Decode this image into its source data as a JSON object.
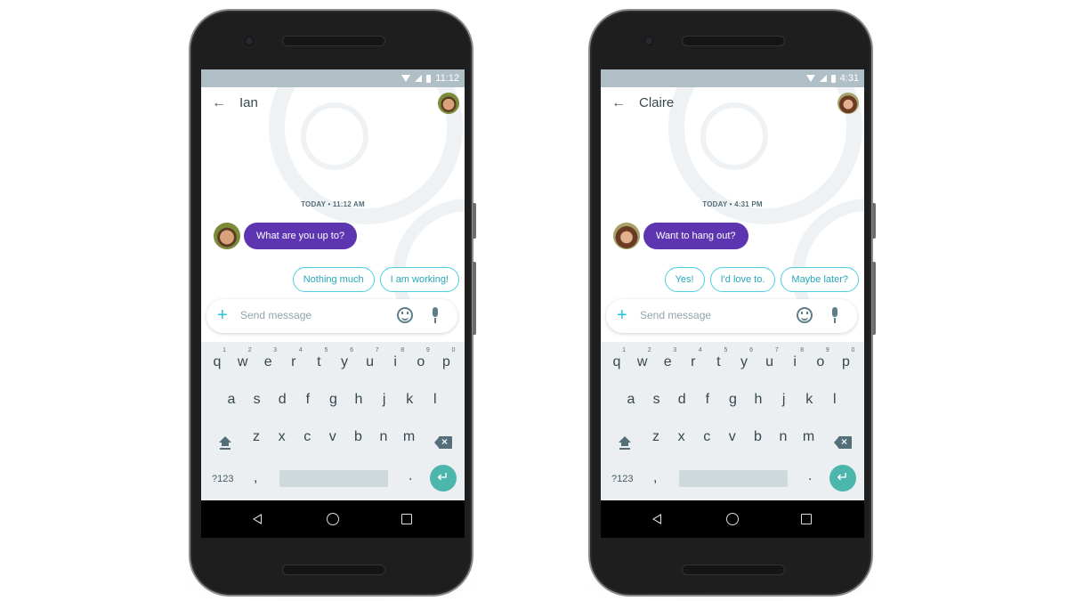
{
  "phones": [
    {
      "status_time": "11:12",
      "contact_name": "Ian",
      "timestamp": "TODAY • 11:12 AM",
      "message": "What are you up to?",
      "smart_replies": [
        "Nothing much",
        "I am working!"
      ],
      "compose_placeholder": "Send message"
    },
    {
      "status_time": "4:31",
      "contact_name": "Claire",
      "timestamp": "TODAY • 4:31 PM",
      "message": "Want to hang out?",
      "smart_replies": [
        "Yes!",
        "I'd love to.",
        "Maybe later?"
      ],
      "compose_placeholder": "Send message"
    }
  ],
  "keyboard": {
    "row1": [
      "q",
      "w",
      "e",
      "r",
      "t",
      "y",
      "u",
      "i",
      "o",
      "p"
    ],
    "row1_nums": [
      "1",
      "2",
      "3",
      "4",
      "5",
      "6",
      "7",
      "8",
      "9",
      "0"
    ],
    "row2": [
      "a",
      "s",
      "d",
      "f",
      "g",
      "h",
      "j",
      "k",
      "l"
    ],
    "row3": [
      "z",
      "x",
      "c",
      "v",
      "b",
      "n",
      "m"
    ],
    "symbols_label": "?123",
    "comma": ",",
    "period": ".",
    "back_arrow": "←",
    "plus": "+",
    "enter": "↵"
  },
  "colors": {
    "status_bar": "#b0bec5",
    "message_bubble": "#5e35b1",
    "chip_border": "#4dd0e1",
    "chip_text": "#26a6b8",
    "enter_key": "#4db6ac"
  }
}
